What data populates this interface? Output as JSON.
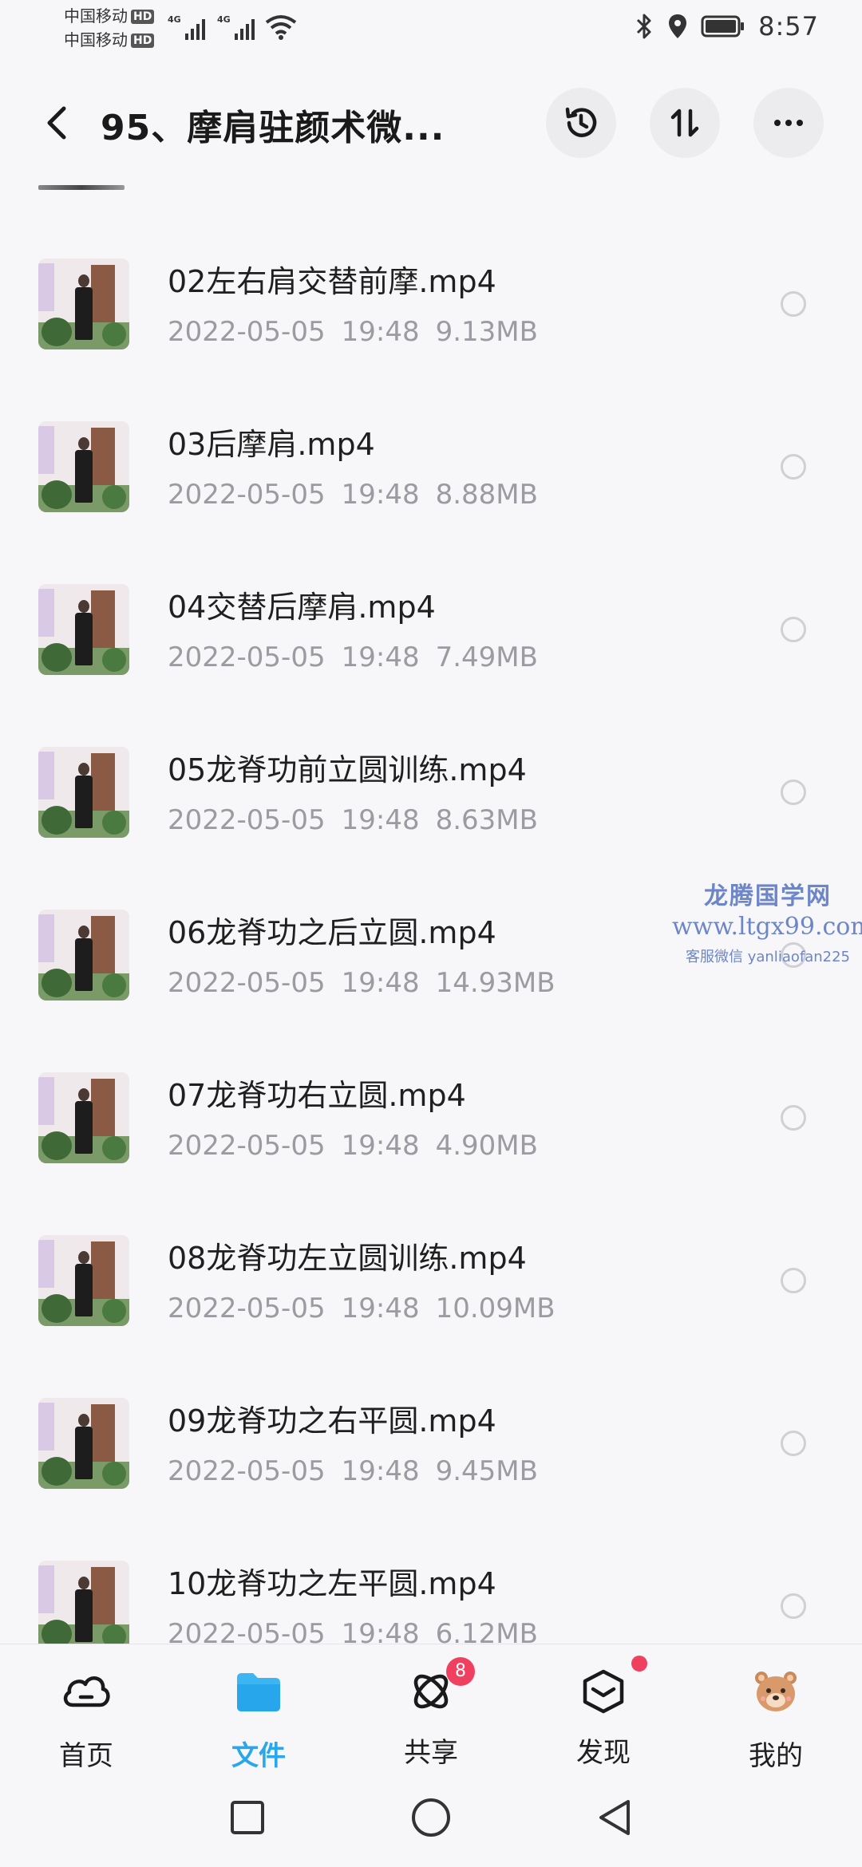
{
  "status_bar": {
    "carrier_1": "中国移动",
    "carrier_2": "中国移动",
    "hd_badge": "HD",
    "network_1": "4G",
    "network_2": "4G",
    "time": "8:57",
    "icons": [
      "signal-icon",
      "wifi-icon",
      "bluetooth-icon",
      "location-icon",
      "battery-icon"
    ]
  },
  "header": {
    "title": "95、摩肩驻颜术微...",
    "actions": [
      "back-icon",
      "history-icon",
      "sort-icon",
      "more-icon"
    ]
  },
  "files": [
    {
      "name": "02左右肩交替前摩.mp4",
      "date": "2022-05-05",
      "time": "19:48",
      "size": "9.13MB"
    },
    {
      "name": "03后摩肩.mp4",
      "date": "2022-05-05",
      "time": "19:48",
      "size": "8.88MB"
    },
    {
      "name": "04交替后摩肩.mp4",
      "date": "2022-05-05",
      "time": "19:48",
      "size": "7.49MB"
    },
    {
      "name": "05龙脊功前立圆训练.mp4",
      "date": "2022-05-05",
      "time": "19:48",
      "size": "8.63MB"
    },
    {
      "name": "06龙脊功之后立圆.mp4",
      "date": "2022-05-05",
      "time": "19:48",
      "size": "14.93MB"
    },
    {
      "name": "07龙脊功右立圆.mp4",
      "date": "2022-05-05",
      "time": "19:48",
      "size": "4.90MB"
    },
    {
      "name": "08龙脊功左立圆训练.mp4",
      "date": "2022-05-05",
      "time": "19:48",
      "size": "10.09MB"
    },
    {
      "name": "09龙脊功之右平圆.mp4",
      "date": "2022-05-05",
      "time": "19:48",
      "size": "9.45MB"
    },
    {
      "name": "10龙脊功之左平圆.mp4",
      "date": "2022-05-05",
      "time": "19:48",
      "size": "6.12MB"
    }
  ],
  "watermark": {
    "title": "龙腾国学网",
    "url": "www.ltgx99.com",
    "contact": "客服微信 yanliaofan225"
  },
  "bottom_nav": {
    "items": [
      {
        "label": "首页",
        "icon": "cloud-home-icon"
      },
      {
        "label": "文件",
        "icon": "folder-icon",
        "active": true
      },
      {
        "label": "共享",
        "icon": "share-atom-icon",
        "badge": "8"
      },
      {
        "label": "发现",
        "icon": "discover-box-icon",
        "dot": true
      },
      {
        "label": "我的",
        "icon": "bear-avatar-icon"
      }
    ]
  },
  "colors": {
    "accent": "#2aa6ea",
    "badge": "#f04060",
    "meta_text": "#9b9ba1",
    "watermark": "#6d86c8"
  }
}
